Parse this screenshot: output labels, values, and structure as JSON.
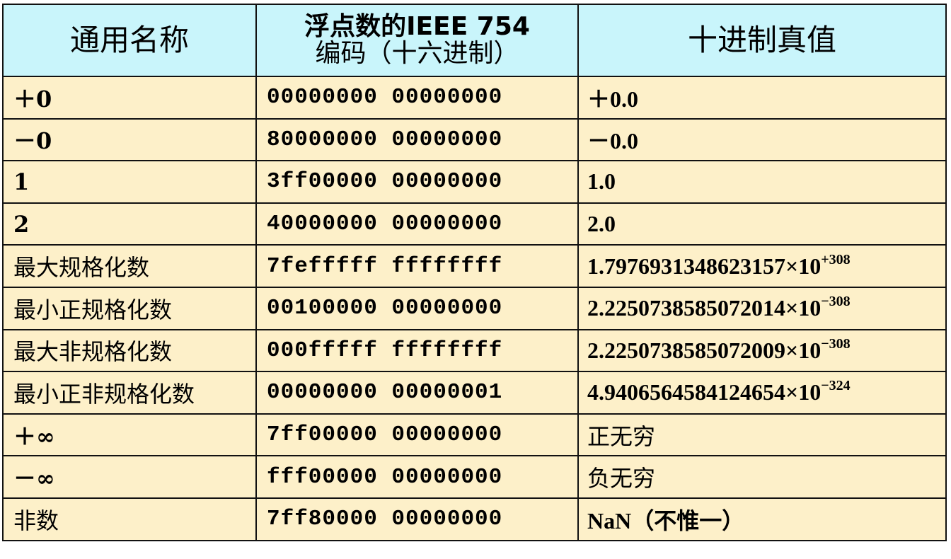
{
  "table": {
    "headers": {
      "name": "通用名称",
      "code_line1": "浮点数的IEEE 754",
      "code_line2": "编码（十六进制）",
      "value": "十进制真值"
    },
    "rows": [
      {
        "name": "＋0",
        "code": "00000000 00000000",
        "value": "＋0.0",
        "exp": ""
      },
      {
        "name": "－0",
        "code": "80000000 00000000",
        "value": "－0.0",
        "exp": ""
      },
      {
        "name": "1",
        "code": "3ff00000 00000000",
        "value": "1.0",
        "exp": ""
      },
      {
        "name": "2",
        "code": "40000000 00000000",
        "value": "2.0",
        "exp": ""
      },
      {
        "name": "最大规格化数",
        "code": "7fefffff ffffffff",
        "value": "1.7976931348623157×10",
        "exp": "+308"
      },
      {
        "name": "最小正规格化数",
        "code": "00100000 00000000",
        "value": "2.2250738585072014×10",
        "exp": "−308"
      },
      {
        "name": "最大非规格化数",
        "code": "000fffff ffffffff",
        "value": "2.2250738585072009×10",
        "exp": "−308"
      },
      {
        "name": "最小正非规格化数",
        "code": "00000000 00000001",
        "value": "4.9406564584124654×10",
        "exp": "−324"
      },
      {
        "name": "＋∞",
        "code": "7ff00000 00000000",
        "value": "正无穷",
        "exp": ""
      },
      {
        "name": "－∞",
        "code": "fff00000 00000000",
        "value": "负无穷",
        "exp": ""
      },
      {
        "name": "非数",
        "code": "7ff80000 00000000",
        "value": "NaN（不惟一）",
        "exp": ""
      }
    ]
  },
  "colors": {
    "header_bg": "#c9f5fb",
    "body_bg": "#fdf0c9",
    "border": "#111111"
  }
}
